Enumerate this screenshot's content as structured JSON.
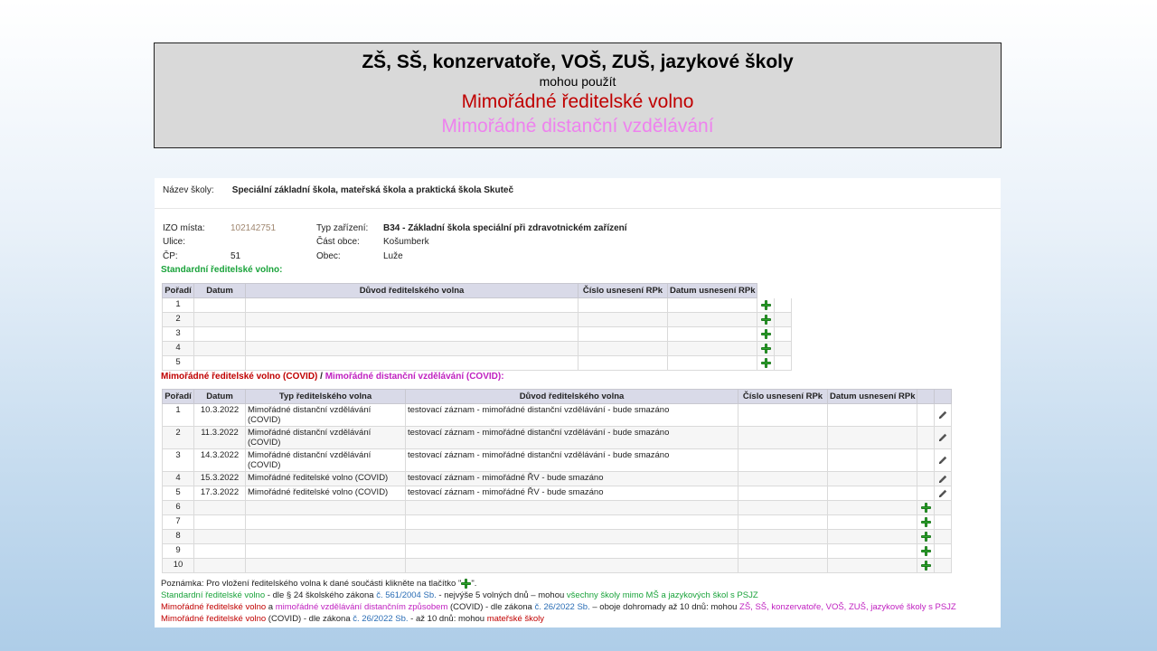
{
  "banner": {
    "title": "ZŠ, SŠ, konzervatoře, VOŠ, ZUŠ, jazykové školy",
    "subtitle": "mohou použít",
    "line_red": "Mimořádné ředitelské volno",
    "line_pink": "Mimořádné distanční vzdělávání"
  },
  "school": {
    "label": "Název školy:",
    "name": "Speciální základní škola, mateřská škola a praktická škola Skuteč"
  },
  "info": {
    "izo_label": "IZO místa:",
    "izo_value": "102142751",
    "ulice_label": "Ulice:",
    "ulice_value": "",
    "cp_label": "ČP:",
    "cp_value": "51",
    "typ_label": "Typ zařízení:",
    "typ_code": "B34",
    "typ_value": " - Základní škola speciální při zdravotnickém zařízení",
    "cast_label": "Část obce:",
    "cast_value": "Košumberk",
    "obec_label": "Obec:",
    "obec_value": "Luže"
  },
  "standard": {
    "heading": "Standardní ředitelské volno:",
    "columns": [
      "Pořadí",
      "Datum",
      "Důvod ředitelského volna",
      "Číslo usnesení RPk",
      "Datum usnesení RPk"
    ],
    "rows": [
      "1",
      "2",
      "3",
      "4",
      "5"
    ],
    "add_icon": "plus-icon"
  },
  "covid": {
    "heading_red": "Mimořádné ředitelské volno (COVID)",
    "heading_sep": " / ",
    "heading_mag": "Mimořádné distanční vzdělávání (COVID):",
    "columns": [
      "Pořadí",
      "Datum",
      "Typ ředitelského volna",
      "Důvod ředitelského volna",
      "Číslo usnesení RPk",
      "Datum usnesení RPk"
    ],
    "rows": [
      {
        "n": "1",
        "date": "10.3.2022",
        "type": "Mimořádné distanční vzdělávání (COVID)",
        "reason": "testovací záznam - mimořádné distanční vzdělávání - bude smazáno"
      },
      {
        "n": "2",
        "date": "11.3.2022",
        "type": "Mimořádné distanční vzdělávání (COVID)",
        "reason": "testovací záznam - mimořádné distanční vzdělávání - bude smazáno"
      },
      {
        "n": "3",
        "date": "14.3.2022",
        "type": "Mimořádné distanční vzdělávání (COVID)",
        "reason": "testovací záznam - mimořádné distanční vzdělávání - bude smazáno"
      },
      {
        "n": "4",
        "date": "15.3.2022",
        "type": "Mimořádné ředitelské volno (COVID)",
        "reason": "testovací záznam - mimořádné ŘV - bude smazáno"
      },
      {
        "n": "5",
        "date": "17.3.2022",
        "type": "Mimořádné ředitelské volno (COVID)",
        "reason": "testovací záznam - mimořádné ŘV - bude smazáno"
      }
    ],
    "empty_rows": [
      "6",
      "7",
      "8",
      "9",
      "10"
    ],
    "edit_icon": "pencil-icon"
  },
  "notes": {
    "n1a": "Poznámka: Pro vložení ředitelského volna k dané součásti klikněte na tlačítko \"",
    "n1b": "\".",
    "n2a": "Standardní ředitelské volno",
    "n2b": " - dle § 24 školského zákona ",
    "n2c": "č. 561/2004 Sb.",
    "n2d": " - nejvýše 5 volných dnů – mohou ",
    "n2e": "všechny školy mimo MŠ a jazykových škol s PSJZ",
    "n3a": "Mimořádné ředitelské volno",
    "n3b": " a ",
    "n3c": "mimořádné vzdělávání distančním způsobem",
    "n3d": " (COVID) - dle zákona ",
    "n3e": "č. 26/2022 Sb.",
    "n3f": " – oboje dohromady až 10 dnů: mohou ",
    "n3g": "ZŠ, SŠ, konzervatoře, VOŠ, ZUŠ, jazykové školy s PSJZ",
    "n4a": "Mimořádné ředitelské volno",
    "n4b": " (COVID) - dle zákona ",
    "n4c": "č. 26/2022 Sb.",
    "n4d": " - až 10 dnů: mohou ",
    "n4e": "mateřské školy"
  }
}
